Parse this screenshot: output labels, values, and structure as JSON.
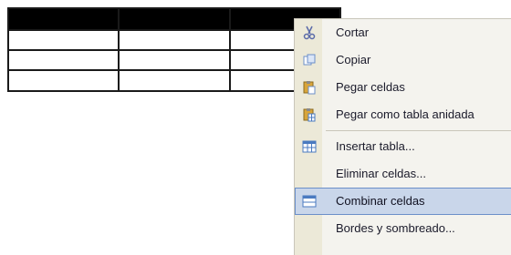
{
  "table": {
    "rows": 4,
    "cols": 3,
    "selected_row": 0
  },
  "context_menu": {
    "items": [
      {
        "label": "Cortar",
        "icon": "scissors-icon",
        "accent": "#5a6aa8"
      },
      {
        "label": "Copiar",
        "icon": "copy-icon",
        "accent": "#6b8fc9"
      },
      {
        "label": "Pegar celdas",
        "icon": "paste-icon",
        "accent": "#d9a53a"
      },
      {
        "label": "Pegar como tabla anidada",
        "icon": "paste-table-icon",
        "accent": "#d9a53a"
      },
      {
        "label": "Insertar tabla...",
        "icon": "insert-table-icon",
        "accent": "#4a7ac0"
      },
      {
        "label": "Eliminar celdas...",
        "icon": "",
        "accent": ""
      },
      {
        "label": "Combinar celdas",
        "icon": "merge-cells-icon",
        "accent": "#4a7ac0",
        "highlighted": true
      },
      {
        "label": "Bordes y sombreado...",
        "icon": "",
        "accent": ""
      }
    ],
    "highlight_color": "#c9d6ea",
    "highlight_border": "#6b8fc9"
  }
}
